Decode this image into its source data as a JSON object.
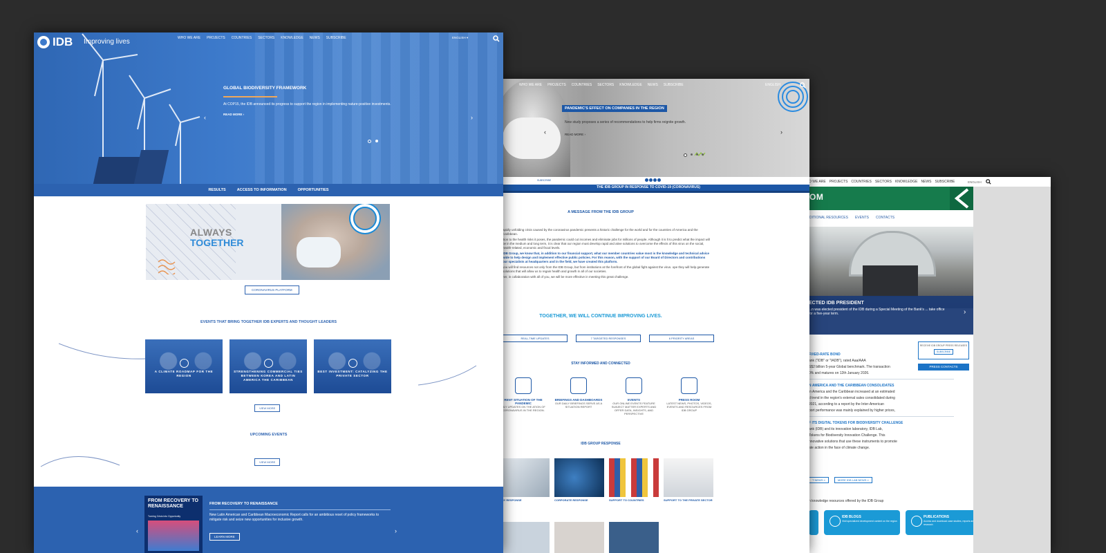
{
  "page3": {
    "top_nav": [
      "WHO WE ARE",
      "PROJECTS",
      "COUNTRIES",
      "SECTORS",
      "KNOWLEDGE",
      "NEWS",
      "SUBSCRIBE"
    ],
    "top_nav_first_visible": "O WE ARE",
    "language": "ENGLISH",
    "header_title": "OM",
    "subnav": [
      "DITIONAL RESOURCES",
      "EVENTS",
      "CONTACTS"
    ],
    "banner_title": "ECTED IDB PRESIDENT",
    "banner_text": "...n was elected president of the IDB during a Special Meeting of the Bank's ... take office for a five-year term.",
    "news": [
      {
        "title": "FIXED-RATE BOND",
        "lines": [
          "ank (\"IDB\" or \"IADB\"), rated Aaa/AAA",
          "S$2 billion 5-year Global benchmark. The transaction",
          "0% and matures on 12th January 2026."
        ]
      },
      {
        "title": "N AMERICA AND THE CARIBBEAN CONSOLIDATES",
        "lines": [
          "in America and the Caribbean increased at an estimated",
          "d trend in the region's external sales consolidated during",
          "2021, according to a report by the Inter-American",
          "port performance was mainly explained by higher prices,"
        ]
      },
      {
        "title": "F ITS DIGITAL TOKENS FOR BIODIVERSITY CHALLENGE",
        "lines": [
          "ank (IDB) and its innovation laboratory, IDB Lab,",
          "Tokens for Biodiversity Innovation Challenge. This",
          "nnovative solutions that use these instruments to promote",
          "ate action in the face of climate change."
        ]
      }
    ],
    "side_box_text": "RECEIVE IDB GROUP PRESS RELEASES",
    "side_box_button": "SUBSCRIBE",
    "press_contacts": "PRESS CONTACTS",
    "link_news": "T NEWS »",
    "link_lab_news": "MORE IDB LAB NEWS »",
    "knowledge_line": "n knowledge resources offered by the IDB Group",
    "tiles": [
      {
        "title": "",
        "desc": ""
      },
      {
        "title": "IDB BLOGS",
        "desc": "Visit specialized development content on the region"
      },
      {
        "title": "PUBLICATIONS",
        "desc": "Access and download case studies, reports and research"
      }
    ]
  },
  "page2": {
    "nav": [
      "WHO WE ARE",
      "PROJECTS",
      "COUNTRIES",
      "SECTORS",
      "KNOWLEDGE",
      "NEWS",
      "SUBSCRIBE"
    ],
    "language": "ENGLISH",
    "hero_tag": "PANDEMIC'S EFFECT ON COMPANIES IN THE REGION",
    "hero_desc": "New study proposes a series of recommendations to help firms reignite growth.",
    "read_more": "READ MORE",
    "subscribe": "SUBSCRIBE",
    "band": "THE IDB GROUP IN RESPONSE TO COVID-19 (CORONAVIRUS)",
    "message_heading": "A MESSAGE FROM THE IDB GROUP",
    "paragraphs": [
      "apidly unfolding crisis caused by the coronavirus pandemic presents a historic challenge for the world and for the countries of America and the Caribbean.",
      "ition to the health risks it poses, the pandemic could cut incomes and eliminate jobs for millions of people. Although it is lt to predict what the impact will be in the medium and long term, it is clear that our region must develop rapid and ative solutions to overcome the effects of this virus on the social, health-related, economic and fiscal levels.",
      "IDB Group, we know that, in addition to our financial support, what our member countries value most is the knowledge and technical advice wide to help design and implement effective public policies. For this reason, with the support of our Board of Directors and contributions our specialists at headquarters and in the field, we have created this platform.",
      "you will find resources not only from the IDB Group, but from institutions at the forefront of the global fight against the virus. ope they will help generate solutions that will allow us to regain health and growth in all of our societies.",
      "her, in collaboration with all of you, we will be more effective in meeting this great challenge."
    ],
    "together": "TOGETHER, WE WILL CONTINUE IMPROVING LIVES.",
    "pills": [
      "REAL-TIME UPDATES",
      "7 TARGETED RESPONSES",
      "6 PRIORITY AREAS"
    ],
    "stay_heading": "STAY INFORMED AND CONNECTED",
    "features": [
      {
        "title": "RENT SITUATION OF THE PANDEMIC",
        "desc": "AILY UPDATES ON THE ATION OF CORONAVIRUS IN THE REGION."
      },
      {
        "title": "BRIEFINGS AND DASHBOARDS",
        "desc": "OUR DAILY BRIEFINGS SERVE AS A SITUATION REPORT"
      },
      {
        "title": "EVENTS",
        "desc": "OUR ONLINE EVENTS FEATURE SUBJECT MATTER EXPERTS AND OFFER DATA, INSIGHTS, AND PERSPECTIVE"
      },
      {
        "title": "PRESS ROOM",
        "desc": "LATEST NEWS, PHOTOS, VIDEOS, EVENTS AND RESOURCES FROM IDB GROUP"
      }
    ],
    "response_heading": "IDB GROUP RESPONSE",
    "responses": [
      "ARY RESPONSE",
      "CORPORATE RESPONSE",
      "SUPPORT TO COUNTRIES",
      "SUPPORT TO THE PRIVATE SECTOR"
    ],
    "colors": {
      "primary": "#1c57a6",
      "accent": "#1b9ad6"
    }
  },
  "page1": {
    "logo": "IDB",
    "tagline": "Improving lives",
    "nav": [
      "WHO WE ARE",
      "PROJECTS",
      "COUNTRIES",
      "SECTORS",
      "KNOWLEDGE",
      "NEWS",
      "SUBSCRIBE"
    ],
    "language": "ENGLISH",
    "hero_title": "GLOBAL BIODIVERSITY FRAMEWORK",
    "hero_desc": "At COP15, the IDB announced its progress to support the region in implementing nature-positive investments.",
    "read_more": "READ MORE",
    "subnav": [
      "RESULTS",
      "ACCESS TO INFORMATION",
      "OPPORTUNITIES"
    ],
    "promo_line1": "ALWAYS",
    "promo_line2": "TOGETHER",
    "coronavirus_button": "CORONAVIRUS PLATFORM",
    "events_heading": "EVENTS THAT BRING TOGETHER IDB EXPERTS AND THOUGHT LEADERS",
    "cards": [
      "A CLIMATE ROADMAP FOR THE REGION",
      "STRENGTHENING COMMERCIAL TIES BETWEEN KOREA AND LATIN AMERICA THE CARIBBEAN",
      "BEST INVESTMENT: CATALYZING THE PRIVATE SECTOR"
    ],
    "view_more": "VIEW MORE",
    "upcoming_heading": "UPCOMING EVENTS",
    "footer_book_title": "FROM RECOVERY TO RENAISSANCE",
    "footer_book_sub": "Turning Crisis into Opportunity",
    "footer_title": "FROM RECOVERY TO RENAISSANCE",
    "footer_desc": "New Latin American and Caribbean Macroeconomic Report calls for an ambitious reset of policy frameworks to mitigate risk and seize new opportunities for inclusive growth.",
    "learn_more": "LEARN MORE",
    "colors": {
      "primary": "#2c62b0",
      "hero": "#3d7acb",
      "accent_line": "#f0a85a"
    }
  }
}
